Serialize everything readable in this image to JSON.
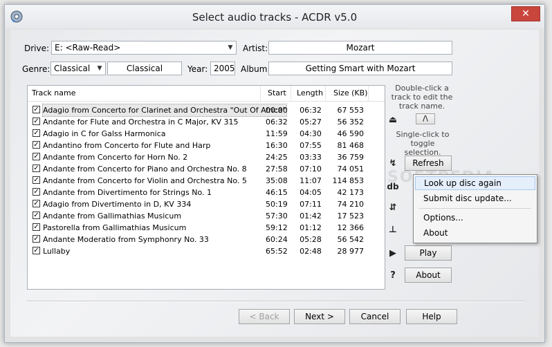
{
  "window": {
    "title": "Select audio tracks - ACDR v5.0",
    "close_symbol": "✕"
  },
  "drive": {
    "label": "Drive:",
    "value": "E: <Raw-Read>"
  },
  "artist": {
    "label": "Artist:",
    "value": "Mozart"
  },
  "genre": {
    "label": "Genre:",
    "value": "Classical",
    "text": "Classical"
  },
  "year": {
    "label": "Year:",
    "value": "2005"
  },
  "album": {
    "label": "Album:",
    "value": "Getting Smart with Mozart"
  },
  "columns": {
    "name": "Track name",
    "start": "Start",
    "length": "Length",
    "size": "Size (KB)"
  },
  "tracks": [
    {
      "name": "Adagio from Concerto for Clarinet and Orchestra \"Out Of Africa\"",
      "start": "00:00",
      "length": "06:32",
      "size": "67 553"
    },
    {
      "name": "Andante for Flute and Orchestra in C Major, KV 315",
      "start": "06:32",
      "length": "05:27",
      "size": "56 352"
    },
    {
      "name": "Adagio in C for Galss Harmonica",
      "start": "11:59",
      "length": "04:30",
      "size": "46 590"
    },
    {
      "name": "Andantino from Concerto for Flute and Harp",
      "start": "16:30",
      "length": "07:55",
      "size": "81 468"
    },
    {
      "name": "Andante from Concerto for Horn No. 2",
      "start": "24:25",
      "length": "03:33",
      "size": "36 759"
    },
    {
      "name": "Andante from Concerto for Piano and Orchestra No. 8",
      "start": "27:58",
      "length": "07:10",
      "size": "74 051"
    },
    {
      "name": "Andante from Concerto for Violin and Orchestra No. 5",
      "start": "35:08",
      "length": "11:07",
      "size": "114 853"
    },
    {
      "name": "Andante from Divertimento for Strings No. 1",
      "start": "46:15",
      "length": "04:05",
      "size": "42 173"
    },
    {
      "name": "Adagio from Divertimento in D, KV 334",
      "start": "50:19",
      "length": "07:11",
      "size": "74 210"
    },
    {
      "name": "Andante from Gallimathias Musicum",
      "start": "57:30",
      "length": "01:42",
      "size": "17 523"
    },
    {
      "name": "Pastorella from Gallimathias Musicum",
      "start": "59:12",
      "length": "01:12",
      "size": "12 366"
    },
    {
      "name": "Andante Moderatio from Symphonry No. 33",
      "start": "60:24",
      "length": "05:28",
      "size": "56 542"
    },
    {
      "name": "Lullaby",
      "start": "65:52",
      "length": "02:48",
      "size": "28 977"
    }
  ],
  "hints": {
    "edit": "Double-click a track to edit the track name.",
    "toggle": "Single-click to toggle selection."
  },
  "side": {
    "eject_symbol": "⏏",
    "reverse_label": "/\\",
    "refresh_label": "Refresh",
    "refresh_symbol": "↯",
    "db_symbol": "db",
    "sort_symbol": "⇵",
    "extract_symbol": "⊥",
    "play_label": "Play",
    "play_symbol": "▶",
    "about_label": "About",
    "about_symbol": "?"
  },
  "footer": {
    "back": "< Back",
    "next": "Next >",
    "cancel": "Cancel",
    "help": "Help"
  },
  "context_menu": {
    "lookup": "Look up disc again",
    "submit": "Submit disc update...",
    "options": "Options...",
    "about": "About"
  },
  "watermark": "SOFTPEDIA",
  "colors": {
    "close": "#c9463d",
    "highlight": "#e5eefb"
  }
}
